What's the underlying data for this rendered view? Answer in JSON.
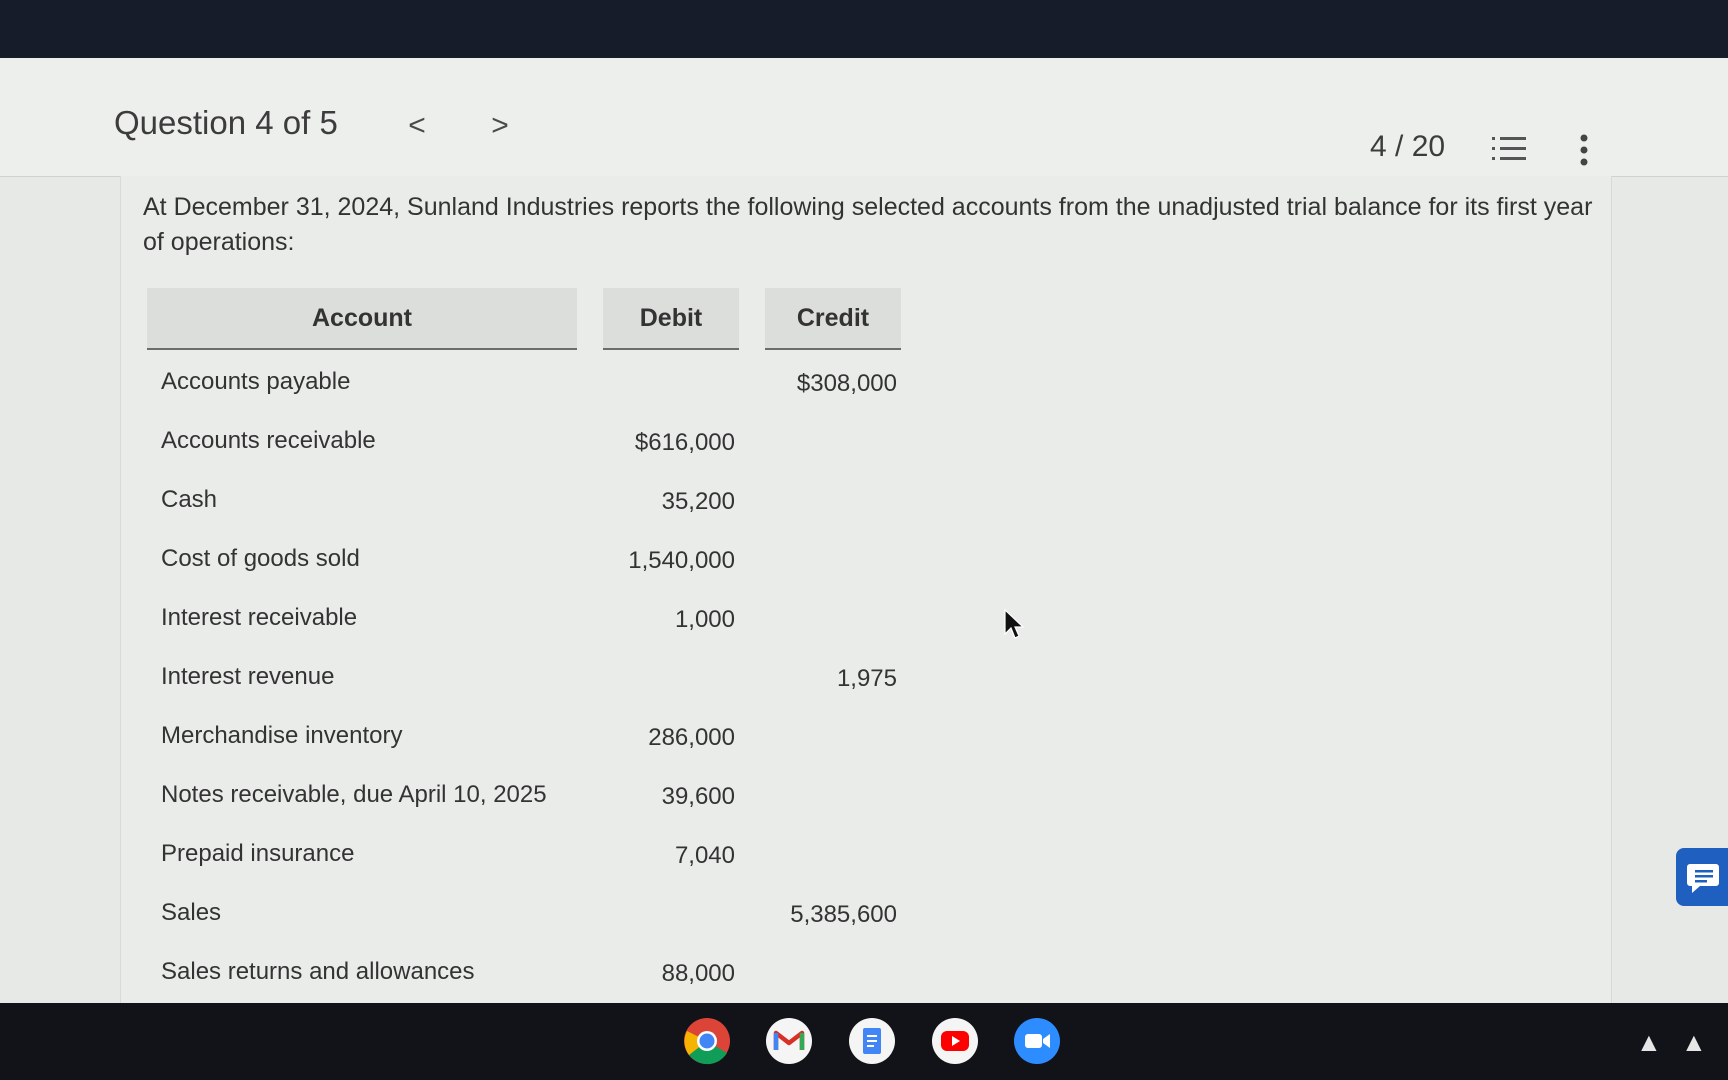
{
  "header": {
    "question_title": "Question 4 of 5",
    "prev": "<",
    "next": ">",
    "score": "4 / 20",
    "list_icon": "list-icon",
    "more_icon": "more-vertical-icon"
  },
  "prompt": "At December 31, 2024, Sunland Industries reports the following selected accounts from the unadjusted trial balance for its first year of operations:",
  "table": {
    "headers": [
      "Account",
      "Debit",
      "Credit"
    ],
    "rows": [
      {
        "account": "Accounts payable",
        "debit": "",
        "credit": "$308,000"
      },
      {
        "account": "Accounts receivable",
        "debit": "$616,000",
        "credit": ""
      },
      {
        "account": "Cash",
        "debit": "35,200",
        "credit": ""
      },
      {
        "account": "Cost of goods sold",
        "debit": "1,540,000",
        "credit": ""
      },
      {
        "account": "Interest receivable",
        "debit": "1,000",
        "credit": ""
      },
      {
        "account": "Interest revenue",
        "debit": "",
        "credit": "1,975"
      },
      {
        "account": "Merchandise inventory",
        "debit": "286,000",
        "credit": ""
      },
      {
        "account": "Notes receivable, due April 10, 2025",
        "debit": "39,600",
        "credit": ""
      },
      {
        "account": "Prepaid insurance",
        "debit": "7,040",
        "credit": ""
      },
      {
        "account": "Sales",
        "debit": "",
        "credit": "5,385,600"
      },
      {
        "account": "Sales returns and allowances",
        "debit": "88,000",
        "credit": ""
      }
    ]
  },
  "taskbar": {
    "apps": [
      "chrome-icon",
      "gmail-icon",
      "docs-icon",
      "youtube-icon",
      "meet-icon"
    ],
    "tray": "▲ ▲"
  },
  "colors": {
    "chat_button": "#1f5fbf",
    "header_bg": "#edefec",
    "table_header_bg": "#dcdedb"
  }
}
